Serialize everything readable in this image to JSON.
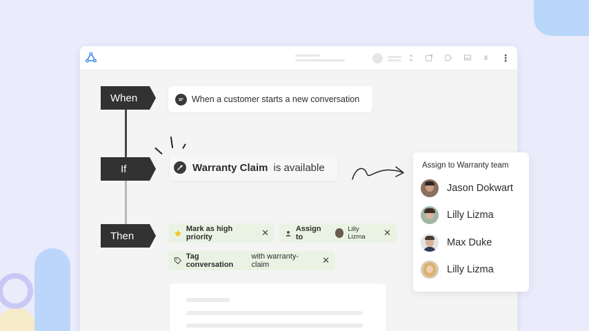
{
  "workflow": {
    "steps": [
      {
        "label": "When"
      },
      {
        "label": "If"
      },
      {
        "label": "Then"
      }
    ],
    "trigger": {
      "icon": "chat-bubble-icon",
      "text": "When a customer starts a new conversation"
    },
    "condition": {
      "icon": "link-off-icon",
      "field": "Warranty Claim",
      "operator": "is available"
    },
    "actions": [
      {
        "icon": "star-icon",
        "label": "Mark as high priority",
        "remove_icon": "close-icon"
      },
      {
        "icon": "person-icon",
        "label": "Assign to",
        "value": "Lilly Lizma",
        "remove_icon": "close-icon"
      },
      {
        "icon": "tag-icon",
        "label": "Tag conversation",
        "value": "with warranty-claim",
        "remove_icon": "close-icon"
      }
    ]
  },
  "assign_panel": {
    "title": "Assign to Warranty team",
    "people": [
      {
        "name": "Jason Dokwart"
      },
      {
        "name": "Lilly Lizma"
      },
      {
        "name": "Max Duke"
      },
      {
        "name": "Lilly Lizma"
      }
    ]
  },
  "titlebar": {
    "small_text": "II"
  },
  "colors": {
    "background": "#eaebfb",
    "step_dark": "#323232",
    "chip_green": "#eaf3e3",
    "accent_blue": "#3a86f0",
    "star_yellow": "#f5c12e"
  }
}
